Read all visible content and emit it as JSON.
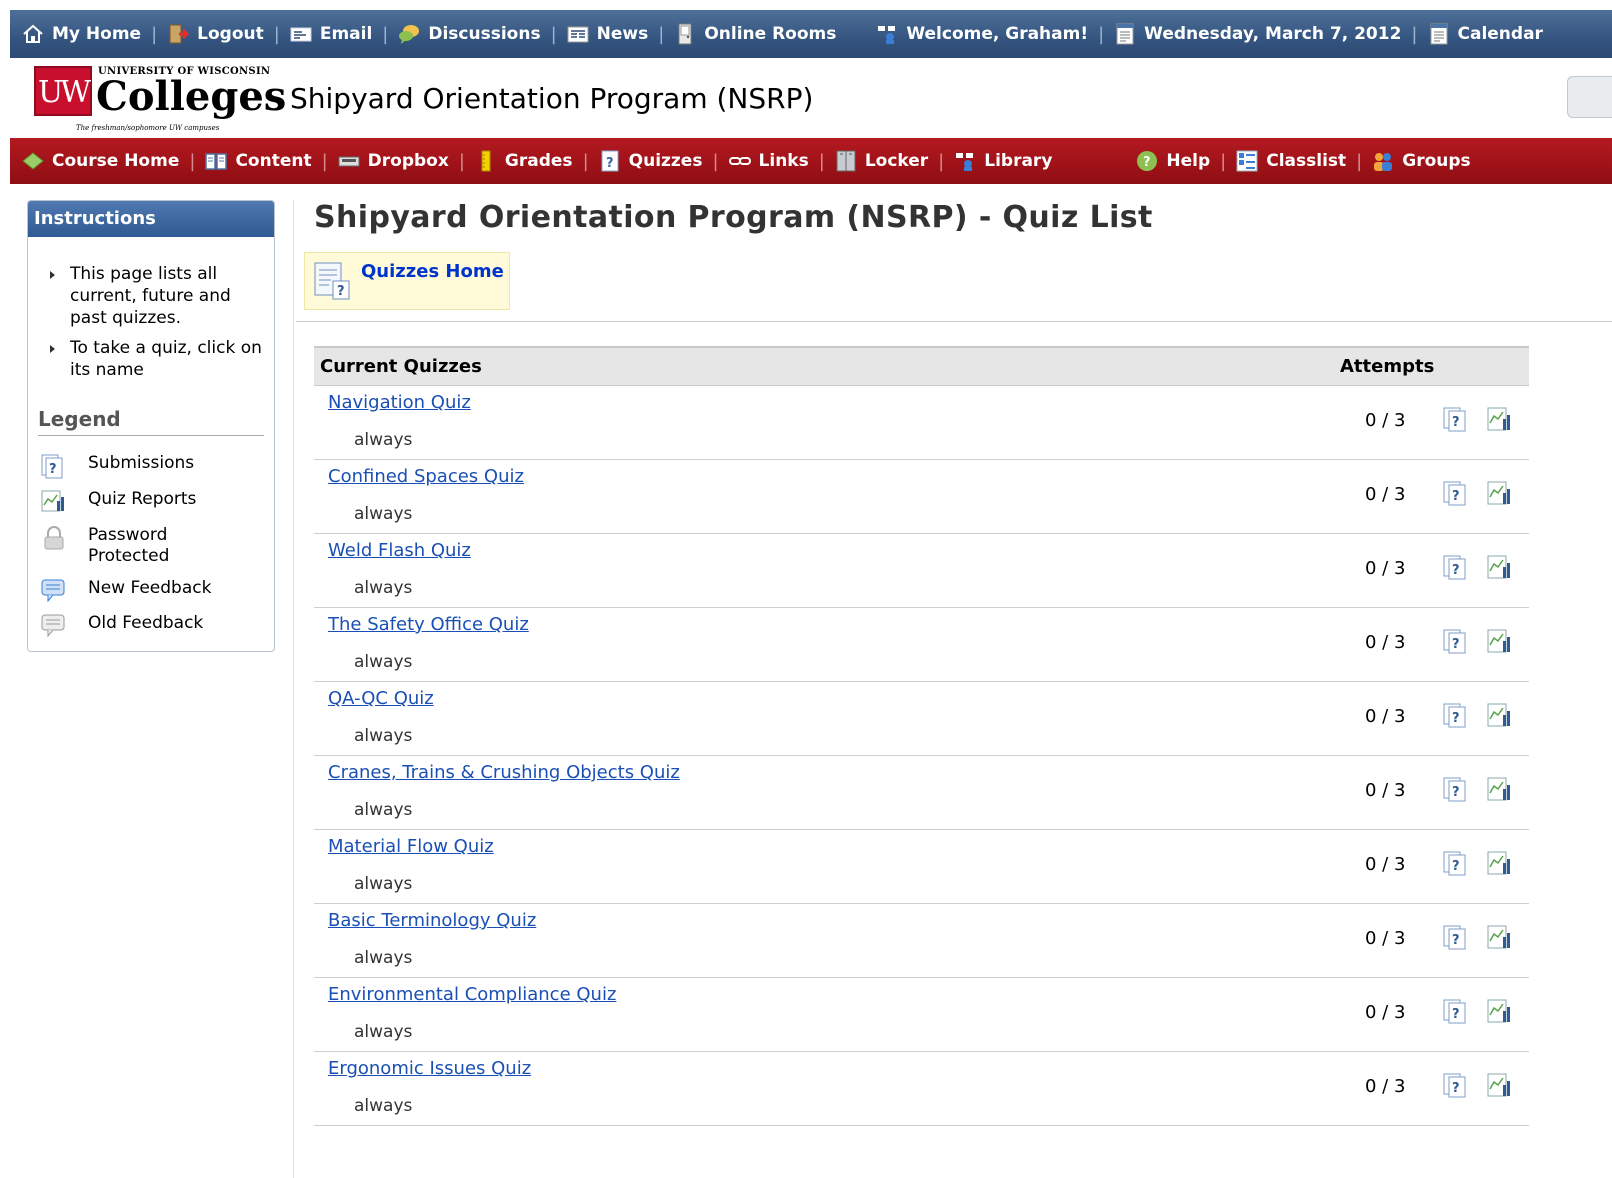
{
  "topnav": {
    "items": [
      {
        "label": "My Home",
        "icon": "home-icon"
      },
      {
        "label": "Logout",
        "icon": "logout-icon"
      },
      {
        "label": "Email",
        "icon": "email-icon"
      },
      {
        "label": "Discussions",
        "icon": "discussions-icon"
      },
      {
        "label": "News",
        "icon": "news-icon"
      },
      {
        "label": "Online Rooms",
        "icon": "online-rooms-icon"
      }
    ],
    "welcome": "Welcome, Graham!",
    "date": "Wednesday, March 7, 2012",
    "calendar": "Calendar"
  },
  "header": {
    "logo_univ": "UNIVERSITY OF WISCONSIN",
    "logo_mark": "UW",
    "logo_name": "Colleges",
    "logo_tagline": "The freshman/sophomore UW campuses",
    "course_title": "Shipyard Orientation Program (NSRP)"
  },
  "coursenav": {
    "items": [
      {
        "label": "Course Home",
        "icon": "course-home-icon"
      },
      {
        "label": "Content",
        "icon": "content-icon"
      },
      {
        "label": "Dropbox",
        "icon": "dropbox-icon"
      },
      {
        "label": "Grades",
        "icon": "grades-icon"
      },
      {
        "label": "Quizzes",
        "icon": "quizzes-icon"
      },
      {
        "label": "Links",
        "icon": "links-icon"
      },
      {
        "label": "Locker",
        "icon": "locker-icon"
      },
      {
        "label": "Library",
        "icon": "library-icon"
      }
    ],
    "right_items": [
      {
        "label": "Help",
        "icon": "help-icon"
      },
      {
        "label": "Classlist",
        "icon": "classlist-icon"
      },
      {
        "label": "Groups",
        "icon": "groups-icon"
      }
    ]
  },
  "sidebar": {
    "title": "Instructions",
    "instructions": [
      "This page lists all current, future and past quizzes.",
      "To take a quiz, click on its name"
    ],
    "legend_title": "Legend",
    "legend": [
      {
        "label": "Submissions",
        "icon": "submissions-icon"
      },
      {
        "label": "Quiz Reports",
        "icon": "quiz-reports-icon"
      },
      {
        "label": "Password Protected",
        "icon": "lock-icon"
      },
      {
        "label": "New Feedback",
        "icon": "new-feedback-icon"
      },
      {
        "label": "Old Feedback",
        "icon": "old-feedback-icon"
      }
    ]
  },
  "main": {
    "title": "Shipyard Orientation Program (NSRP) - Quiz List",
    "quizzes_home": "Quizzes Home",
    "table": {
      "col_name": "Current Quizzes",
      "col_attempts": "Attempts",
      "rows": [
        {
          "name": "Navigation Quiz",
          "availability": "always",
          "attempts": "0 / 3"
        },
        {
          "name": "Confined Spaces Quiz",
          "availability": "always",
          "attempts": "0 / 3"
        },
        {
          "name": "Weld Flash Quiz",
          "availability": "always",
          "attempts": "0 / 3"
        },
        {
          "name": "The Safety Office Quiz",
          "availability": "always",
          "attempts": "0 / 3"
        },
        {
          "name": "QA-QC Quiz",
          "availability": "always",
          "attempts": "0 / 3"
        },
        {
          "name": "Cranes, Trains & Crushing Objects Quiz",
          "availability": "always",
          "attempts": "0 / 3"
        },
        {
          "name": "Material Flow Quiz",
          "availability": "always",
          "attempts": "0 / 3"
        },
        {
          "name": "Basic Terminology Quiz",
          "availability": "always",
          "attempts": "0 / 3"
        },
        {
          "name": "Environmental Compliance Quiz",
          "availability": "always",
          "attempts": "0 / 3"
        },
        {
          "name": "Ergonomic Issues Quiz",
          "availability": "always",
          "attempts": "0 / 3"
        }
      ]
    }
  },
  "colors": {
    "top_bar": "#345580",
    "course_bar": "#9e1218",
    "sidebar_header": "#2f5a92",
    "link": "#1a4fb5",
    "quizzes_home_bg": "#fffbd9"
  }
}
